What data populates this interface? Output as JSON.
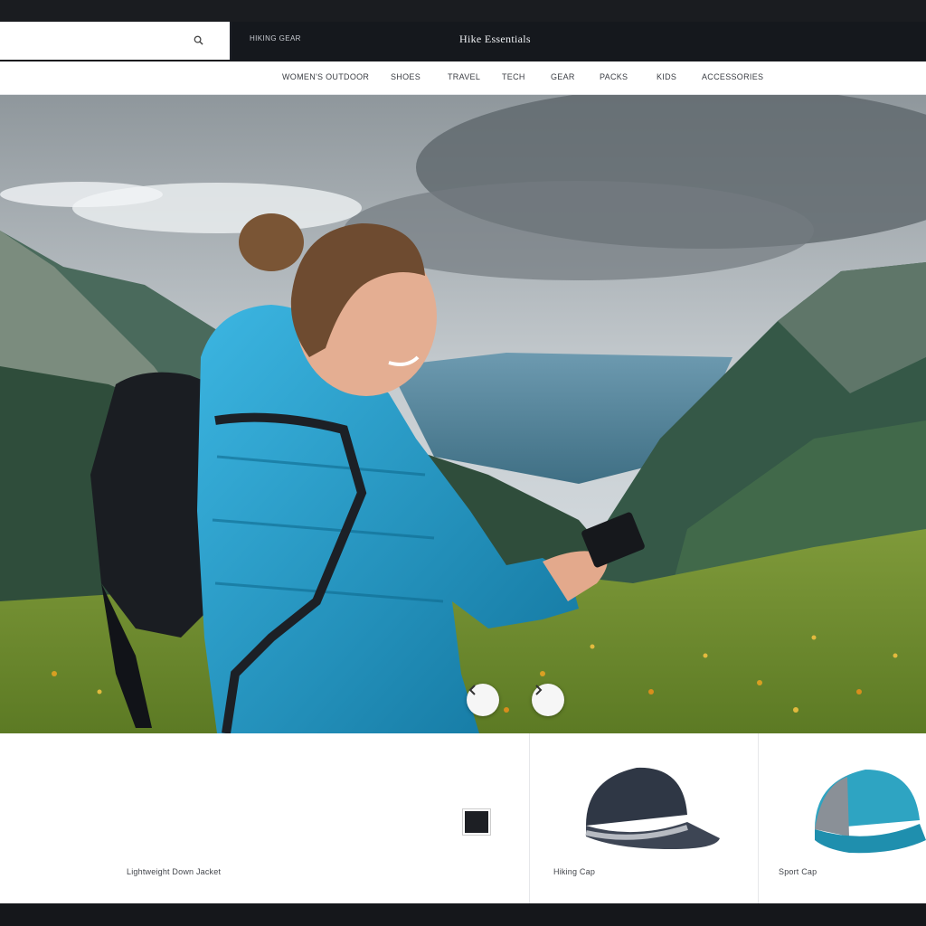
{
  "search": {
    "value": "",
    "placeholder": ""
  },
  "header": {
    "top_link": "HIKING GEAR",
    "brand": "Hike Essentials"
  },
  "nav": {
    "items": [
      {
        "label": "WOMEN'S OUTDOOR"
      },
      {
        "label": "SHOES"
      },
      {
        "label": "TRAVEL"
      },
      {
        "label": "TECH"
      },
      {
        "label": "GEAR"
      },
      {
        "label": "PACKS"
      },
      {
        "label": "KIDS"
      },
      {
        "label": "ACCESSORIES"
      }
    ]
  },
  "products": [
    {
      "label": "Lightweight Down Jacket"
    },
    {
      "label": "Hiking Cap"
    },
    {
      "label": "Sport Cap"
    }
  ],
  "colors": {
    "jacket": "#1f9ac8",
    "cap_dark": "#2f3745",
    "cap_blue": "#2ea4c2"
  }
}
